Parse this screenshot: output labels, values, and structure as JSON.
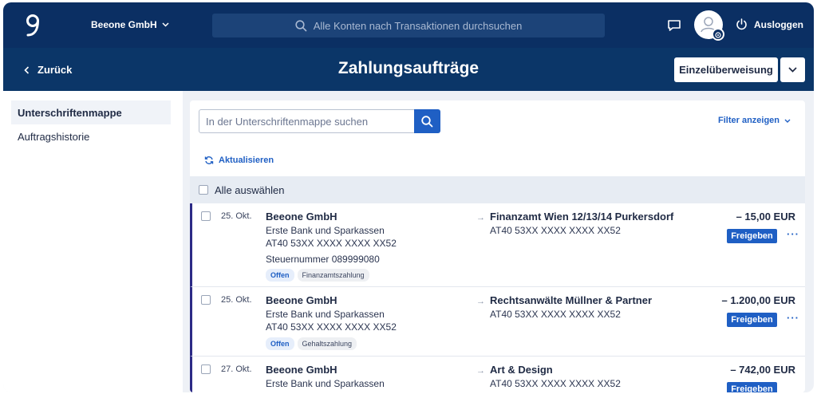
{
  "topbar": {
    "company": "Beeone GmbH",
    "search_placeholder": "Alle Konten nach Transaktionen durchsuchen",
    "logout_label": "Ausloggen"
  },
  "subheader": {
    "back_label": "Zurück",
    "title": "Zahlungsaufträge",
    "primary_button": "Einzelüberweisung"
  },
  "sidebar": {
    "items": [
      {
        "label": "Unterschriftenmappe"
      },
      {
        "label": "Auftragshistorie"
      }
    ]
  },
  "panel": {
    "search_placeholder": "In der Unterschriftenmappe suchen",
    "filter_label": "Filter anzeigen",
    "refresh_label": "Aktualisieren",
    "select_all_label": "Alle auswählen",
    "approve_label": "Freigeben",
    "more_label": "···"
  },
  "payments": [
    {
      "date": "25. Okt.",
      "sender_name": "Beeone GmbH",
      "sender_bank": "Erste Bank und Sparkassen",
      "sender_iban": "AT40 53XX XXXX XXXX XX52",
      "tax_number": "Steuernummer 089999080",
      "status": "Offen",
      "type": "Finanzamtszahlung",
      "recipient_name": "Finanzamt Wien 12/13/14 Purkersdorf",
      "recipient_iban": "AT40 53XX XXXX XXXX XX52",
      "amount": "– 15,00 EUR"
    },
    {
      "date": "25. Okt.",
      "sender_name": "Beeone GmbH",
      "sender_bank": "Erste Bank und Sparkassen",
      "sender_iban": "AT40 53XX XXXX XXXX XX52",
      "status": "Offen",
      "type": "Gehaltszahlung",
      "recipient_name": "Rechtsanwälte Müllner & Partner",
      "recipient_iban": "AT40 53XX XXXX XXXX XX52",
      "amount": "– 1.200,00 EUR"
    },
    {
      "date": "27. Okt.",
      "sender_name": "Beeone GmbH",
      "sender_bank": "Erste Bank und Sparkassen",
      "recipient_name": "Art & Design",
      "recipient_iban": "AT40 53XX XXXX XXXX XX52",
      "amount": "– 742,00 EUR"
    }
  ],
  "colors": {
    "navy": "#0b2f63",
    "accent": "#1f5fc4",
    "row_marker": "#2c2a86"
  }
}
